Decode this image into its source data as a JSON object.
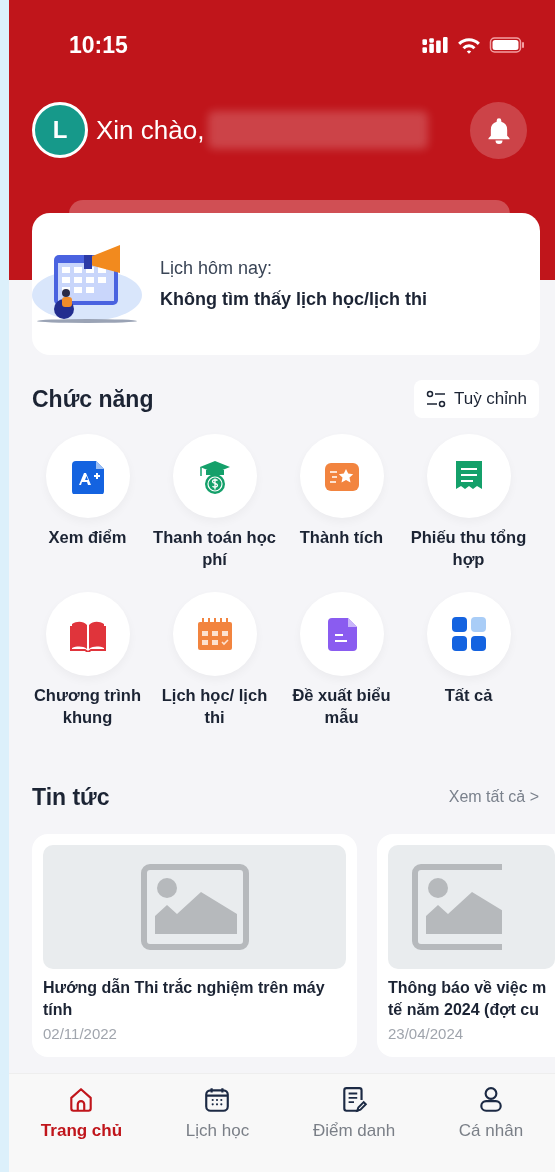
{
  "status_bar": {
    "time": "10:15"
  },
  "header": {
    "avatar_letter": "L",
    "greeting": "Xin chào,"
  },
  "today": {
    "label": "Lịch hôm nay:",
    "message": "Không tìm thấy lịch học/lịch thi"
  },
  "features": {
    "title": "Chức năng",
    "customize_button": "Tuỳ chỉnh",
    "items": [
      {
        "label": "Xem điểm",
        "kind": "grade"
      },
      {
        "label": "Thanh toán học phí",
        "kind": "tuition"
      },
      {
        "label": "Thành tích",
        "kind": "achievement"
      },
      {
        "label": "Phiếu thu tổng hợp",
        "kind": "receipt"
      },
      {
        "label": "Chương trình khung",
        "kind": "curriculum"
      },
      {
        "label": "Lịch học/ lịch thi",
        "kind": "schedule"
      },
      {
        "label": "Đề xuất biểu mẫu",
        "kind": "form"
      },
      {
        "label": "Tất cả",
        "kind": "all"
      }
    ]
  },
  "news": {
    "title": "Tin tức",
    "see_all": "Xem tất cả >",
    "articles": [
      {
        "title_lines": [
          "Hướng dẫn Thi trắc nghiệm trên máy",
          "tính"
        ],
        "date": "02/11/2022"
      },
      {
        "title_lines": [
          "Thông báo về việc m",
          "tế năm 2024 (đợt cu"
        ],
        "date": "23/04/2024"
      }
    ]
  },
  "bottom_nav": [
    {
      "label": "Trang chủ",
      "kind": "home",
      "selected": true
    },
    {
      "label": "Lịch học",
      "kind": "calendar",
      "selected": false
    },
    {
      "label": "Điểm danh",
      "kind": "attendance",
      "selected": false
    },
    {
      "label": "Cá nhân",
      "kind": "profile",
      "selected": false
    }
  ]
}
